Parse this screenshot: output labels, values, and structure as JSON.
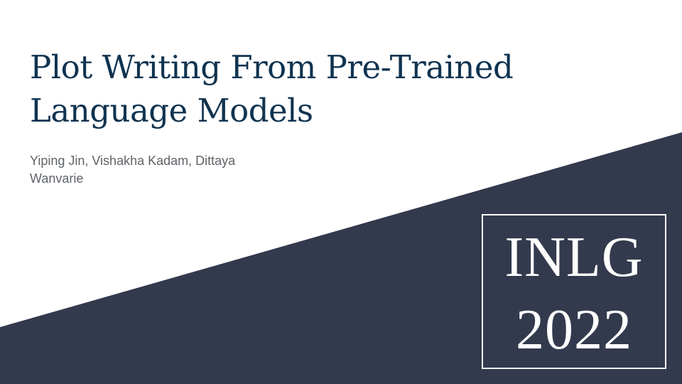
{
  "slide": {
    "title_lines": [
      "Plot Writing From Pre-Trained",
      "Language Models"
    ],
    "author_lines": [
      "Yiping Jin, Vishakha Kadam, Dittaya",
      "Wanvarie"
    ],
    "badge_lines": [
      "INLG",
      "2022"
    ]
  },
  "colors": {
    "title": "#0f3350",
    "authors": "#5f6368",
    "diagonal_fill": "#333a4d",
    "background": "#ffffff",
    "badge_text": "#ffffff"
  }
}
